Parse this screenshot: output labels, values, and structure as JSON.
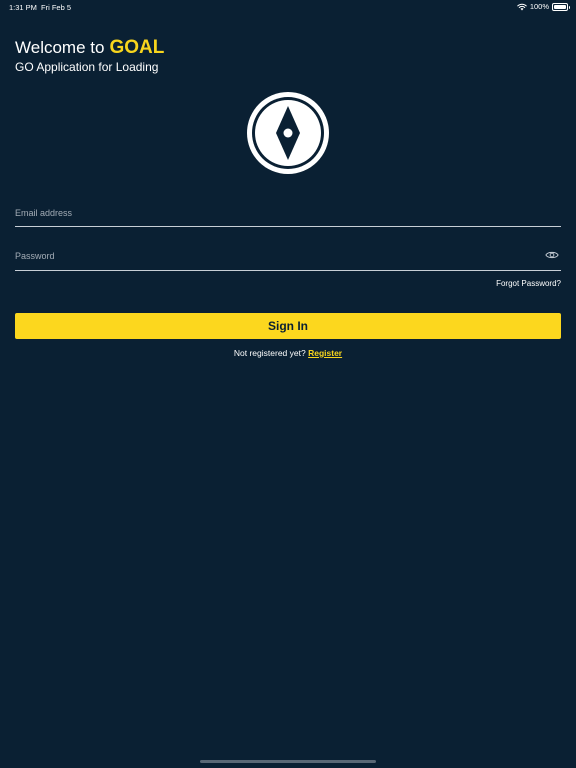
{
  "status_bar": {
    "time": "1:31 PM",
    "date": "Fri Feb 5",
    "battery_level": "100%",
    "battery_fraction": 1.0,
    "icons": [
      "wifi-icon",
      "battery-icon"
    ]
  },
  "header": {
    "welcome_prefix": "Welcome to",
    "brand": "GOAL",
    "subtitle": "GO Application for Loading"
  },
  "logo": {
    "icon": "compass-icon"
  },
  "form": {
    "email": {
      "placeholder": "Email address",
      "value": ""
    },
    "password": {
      "placeholder": "Password",
      "value": "",
      "toggle_icon": "eye-icon"
    },
    "forgot_password_label": "Forgot Password?",
    "sign_in_label": "Sign In",
    "not_registered_text": "Not registered yet?",
    "register_label": "Register"
  },
  "colors": {
    "background": "#0a2033",
    "accent": "#fcd71e",
    "brand_text": "#f7d51d",
    "text": "#ffffff",
    "placeholder": "#a3acb6",
    "field_underline": "#c7ced6"
  }
}
